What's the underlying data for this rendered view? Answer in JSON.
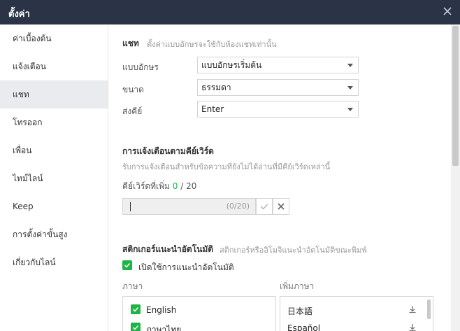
{
  "window": {
    "title": "ตั้งค่า"
  },
  "sidebar": {
    "items": [
      {
        "label": "ค่าเบื้องต้น"
      },
      {
        "label": "แจ้งเตือน"
      },
      {
        "label": "แชท"
      },
      {
        "label": "โทรออก"
      },
      {
        "label": "เพื่อน"
      },
      {
        "label": "ไทม์ไลน์"
      },
      {
        "label": "Keep"
      },
      {
        "label": "การตั้งค่าขั้นสูง"
      },
      {
        "label": "เกี่ยวกับไลน์"
      }
    ],
    "active": "แชท"
  },
  "chat": {
    "title": "แชท",
    "desc": "ตั้งค่าแบบอักษรจะใช้กับห้องแชทเท่านั้น",
    "font_label": "แบบอักษร",
    "font_value": "แบบอักษรเริ่มต้น",
    "size_label": "ขนาด",
    "size_value": "ธรรมดา",
    "send_label": "ส่งคีย์",
    "send_value": "Enter"
  },
  "keyword": {
    "title": "การแจ้งเตือนตามคีย์เวิร์ด",
    "desc": "รับการแจ้งเตือนสำหรับข้อความที่ยังไม่ได้อ่านที่มีคีย์เวิร์ดเหล่านี้",
    "added_label": "คีย์เวิร์ดที่เพิ่ม",
    "added_count": "0",
    "added_sep": "/",
    "added_max": "20",
    "input_counter": "(0/20)"
  },
  "sticker": {
    "title": "สติกเกอร์แนะนำอัตโนมัติ",
    "desc": "สติกเกอร์หรืออิโมจิแนะนำอัตโนมัติขณะพิมพ์",
    "enable_label": "เปิดใช้การแนะนำอัตโนมัติ",
    "enable_checked": true,
    "lang_header": "ภาษา",
    "add_lang_header": "เพิ่มภาษา",
    "languages": [
      {
        "label": "English",
        "checked": true
      },
      {
        "label": "ภาษาไทย",
        "checked": true
      }
    ],
    "add_languages": [
      {
        "label": "日本語",
        "icon": "download-icon"
      },
      {
        "label": "Español",
        "icon": "download-icon"
      }
    ]
  },
  "colors": {
    "accent": "#1db446",
    "titlebar": "#2b3447",
    "active_bg": "#e9ebef"
  }
}
